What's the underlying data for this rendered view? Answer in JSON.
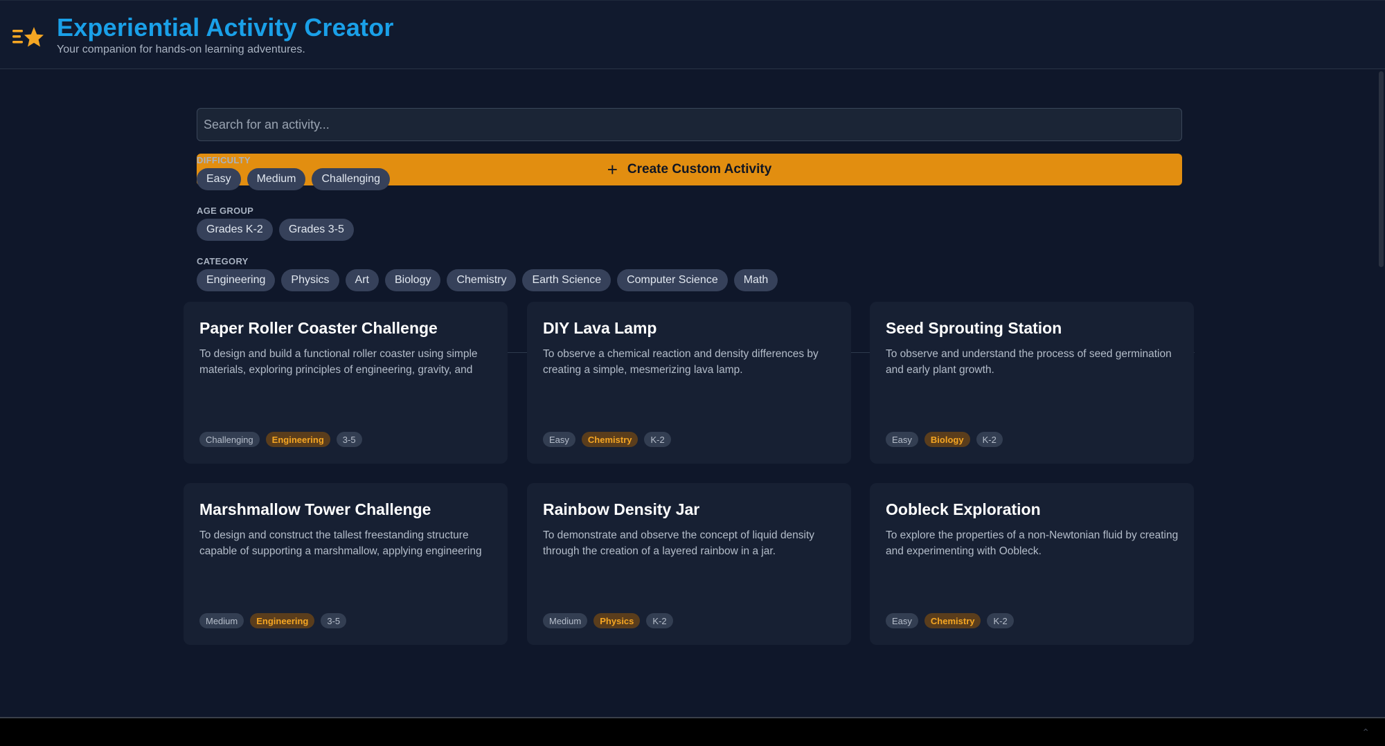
{
  "header": {
    "title": "Experiential Activity Creator",
    "subtitle": "Your companion for hands-on learning adventures.",
    "logo_icon": "menu-star-icon"
  },
  "search": {
    "placeholder": "Search for an activity...",
    "value": ""
  },
  "create_button": {
    "label": "Create Custom Activity",
    "icon": "plus-icon"
  },
  "filters": {
    "difficulty": {
      "label": "DIFFICULTY",
      "options": [
        "Easy",
        "Medium",
        "Challenging"
      ]
    },
    "age_group": {
      "label": "AGE GROUP",
      "options": [
        "Grades K-2",
        "Grades 3-5"
      ]
    },
    "category": {
      "label": "CATEGORY",
      "options": [
        "Engineering",
        "Physics",
        "Art",
        "Biology",
        "Chemistry",
        "Earth Science",
        "Computer Science",
        "Math"
      ]
    }
  },
  "cards": [
    {
      "title": "Paper Roller Coaster Challenge",
      "description": "To design and build a functional roller coaster using simple materials, exploring principles of engineering, gravity, and",
      "difficulty": "Challenging",
      "category": "Engineering",
      "grade": "3-5"
    },
    {
      "title": "DIY Lava Lamp",
      "description": "To observe a chemical reaction and density differences by creating a simple, mesmerizing lava lamp.",
      "difficulty": "Easy",
      "category": "Chemistry",
      "grade": "K-2"
    },
    {
      "title": "Seed Sprouting Station",
      "description": "To observe and understand the process of seed germination and early plant growth.",
      "difficulty": "Easy",
      "category": "Biology",
      "grade": "K-2"
    },
    {
      "title": "Marshmallow Tower Challenge",
      "description": "To design and construct the tallest freestanding structure capable of supporting a marshmallow, applying engineering",
      "difficulty": "Medium",
      "category": "Engineering",
      "grade": "3-5"
    },
    {
      "title": "Rainbow Density Jar",
      "description": "To demonstrate and observe the concept of liquid density through the creation of a layered rainbow in a jar.",
      "difficulty": "Medium",
      "category": "Physics",
      "grade": "K-2"
    },
    {
      "title": "Oobleck Exploration",
      "description": "To explore the properties of a non-Newtonian fluid by creating and experimenting with Oobleck.",
      "difficulty": "Easy",
      "category": "Chemistry",
      "grade": "K-2"
    }
  ],
  "colors": {
    "background": "#0f172a",
    "accent_title": "#1aa0e8",
    "button": "#e28e10",
    "category_tag": "#f5a623"
  }
}
